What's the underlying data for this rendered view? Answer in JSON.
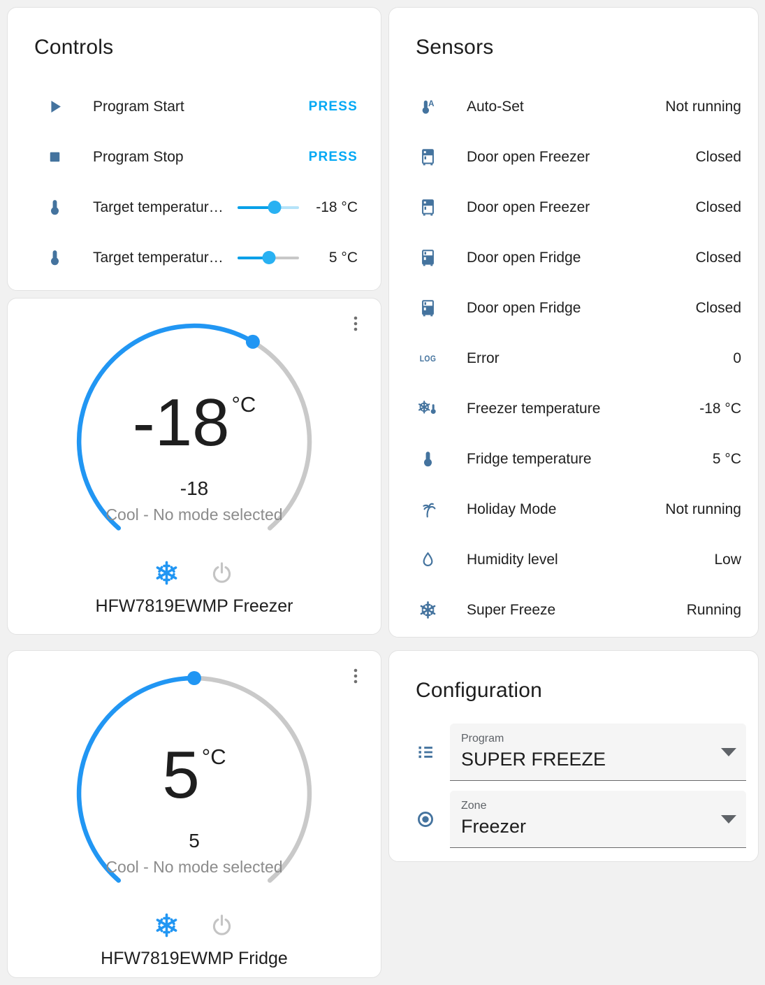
{
  "theme": {
    "icon_color": "#44739e",
    "accent": "#03a9f4",
    "dial_blue": "#2196f3",
    "inactive_arc": "#c9c9c9",
    "text_primary": "#212121",
    "text_secondary": "#8c8c8c"
  },
  "controls": {
    "title": "Controls",
    "rows": [
      {
        "type": "press",
        "icon": "play-icon",
        "label": "Program Start",
        "action": "PRESS"
      },
      {
        "type": "press",
        "icon": "stop-icon",
        "label": "Program Stop",
        "action": "PRESS"
      },
      {
        "type": "slider",
        "icon": "thermometer-icon",
        "label": "Target temperatur…",
        "value": "-18 °C",
        "slider": {
          "percent": 60,
          "track_color": "#b5e3f9"
        }
      },
      {
        "type": "slider",
        "icon": "thermometer-icon",
        "label": "Target temperatur…",
        "value": "5 °C",
        "slider": {
          "percent": 51,
          "track_color": "#c8c8c8"
        }
      }
    ]
  },
  "sensors": {
    "title": "Sensors",
    "rows": [
      {
        "icon": "thermometer-auto-icon",
        "label": "Auto-Set",
        "value": "Not running"
      },
      {
        "icon": "fridge-freezer-icon",
        "label": "Door open Freezer",
        "value": "Closed"
      },
      {
        "icon": "fridge-freezer-icon",
        "label": "Door open Freezer",
        "value": "Closed"
      },
      {
        "icon": "fridge-fridge-icon",
        "label": "Door open Fridge",
        "value": "Closed"
      },
      {
        "icon": "fridge-fridge-icon",
        "label": "Door open Fridge",
        "value": "Closed"
      },
      {
        "icon": "log-icon",
        "label": "Error",
        "value": "0"
      },
      {
        "icon": "snowflake-thermometer-icon",
        "label": "Freezer temperature",
        "value": "-18 °C"
      },
      {
        "icon": "thermometer-icon",
        "label": "Fridge temperature",
        "value": "5 °C"
      },
      {
        "icon": "palm-tree-icon",
        "label": "Holiday Mode",
        "value": "Not running"
      },
      {
        "icon": "water-drop-icon",
        "label": "Humidity level",
        "value": "Low"
      },
      {
        "icon": "snowflake-icon",
        "label": "Super Freeze",
        "value": "Running"
      }
    ]
  },
  "thermostats": [
    {
      "name": "HFW7819EWMP Freezer",
      "temp": "-18",
      "unit": "°C",
      "target": "-18",
      "mode_text": "Cool - No mode selected",
      "slider_percent": 61,
      "mode_icons": [
        {
          "icon": "snowflake-icon",
          "active": true
        },
        {
          "icon": "power-icon",
          "active": false
        }
      ]
    },
    {
      "name": "HFW7819EWMP Fridge",
      "temp": "5",
      "unit": "°C",
      "target": "5",
      "mode_text": "Cool - No mode selected",
      "slider_percent": 50,
      "mode_icons": [
        {
          "icon": "snowflake-icon",
          "active": true
        },
        {
          "icon": "power-icon",
          "active": false
        }
      ]
    }
  ],
  "configuration": {
    "title": "Configuration",
    "fields": [
      {
        "icon": "list-icon",
        "label": "Program",
        "value": "SUPER FREEZE"
      },
      {
        "icon": "radio-circle-icon",
        "label": "Zone",
        "value": "Freezer"
      }
    ]
  }
}
